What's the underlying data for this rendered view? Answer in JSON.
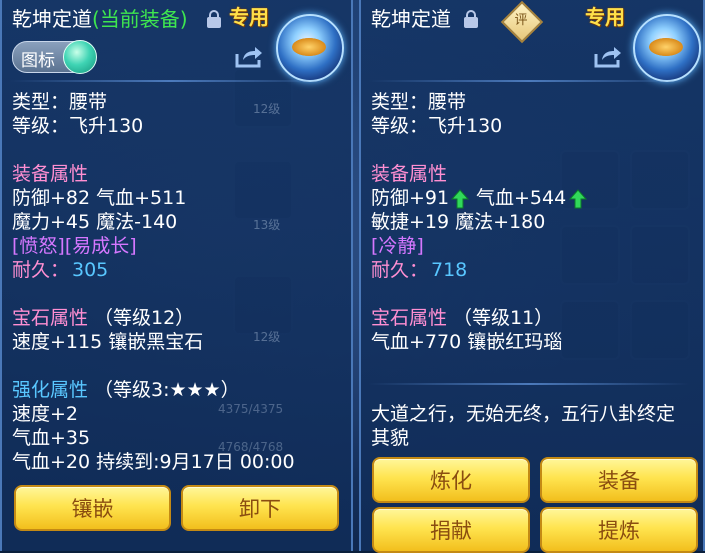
{
  "left": {
    "title_name": "乾坤定道",
    "title_tag": "(当前装备)",
    "zhuan": "专用",
    "toggle_label": "图标",
    "type_line": "类型：腰带",
    "level_line": "等级：飞升130",
    "equip_attr_title": "装备属性",
    "attr1": "防御+82 气血+511",
    "attr2": "魔力+45 魔法-140",
    "special": "[愤怒][易成长]",
    "durability_label": "耐久：",
    "durability_value": "305",
    "gem_title": "宝石属性",
    "gem_level": "（等级12）",
    "gem_line": "速度+115 镶嵌黑宝石",
    "enh_title": "强化属性",
    "enh_level": "（等级3:★★★）",
    "enh1": "速度+2",
    "enh2": "气血+35",
    "enh3": "气血+20    持续到:9月17日 00:00",
    "btn_inlay": "镶嵌",
    "btn_unequip": "卸下"
  },
  "right": {
    "title_name": "乾坤定道",
    "ping": "评",
    "zhuan": "专用",
    "type_line": "类型：腰带",
    "level_line": "等级：飞升130",
    "equip_attr_title": "装备属性",
    "attr1_a": "防御+91",
    "attr1_b": "气血+544",
    "attr2": "敏捷+19 魔法+180",
    "special": "[冷静]",
    "durability_label": "耐久：",
    "durability_value": "718",
    "gem_title": "宝石属性",
    "gem_level": "（等级11）",
    "gem_line": "气血+770 镶嵌红玛瑙",
    "desc1": "大道之行，无始无终，五行八卦终定",
    "desc2": "其貌",
    "btn_refine": "炼化",
    "btn_equip": "装备",
    "btn_donate": "捐献",
    "btn_extract": "提炼"
  },
  "background_hints": {
    "slot_labels": [
      "12级",
      "13级",
      "12级"
    ],
    "bar_values": [
      "4375/4375",
      "4768/4768"
    ]
  }
}
